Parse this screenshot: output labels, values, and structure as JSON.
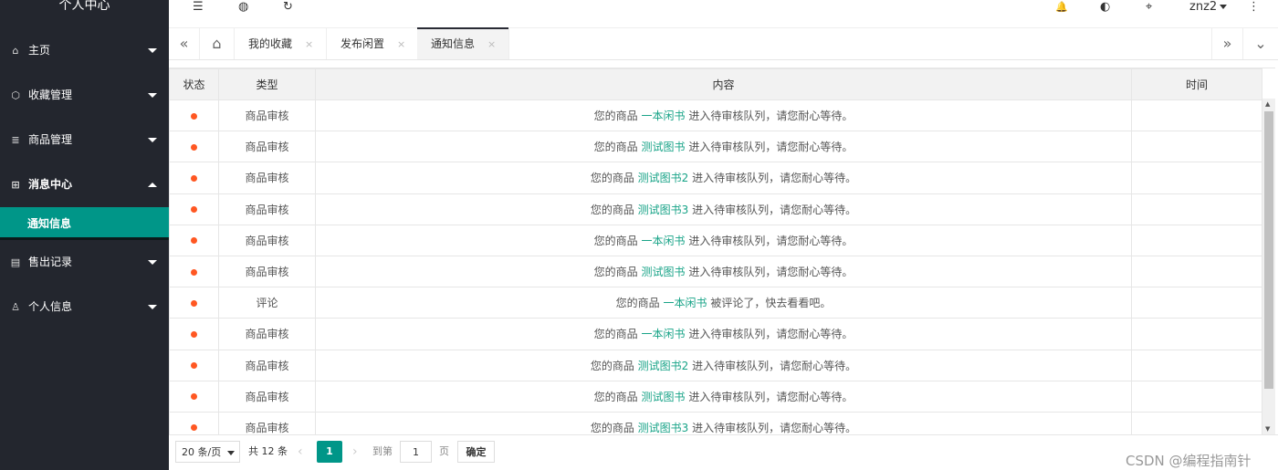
{
  "app_title": "个人中心",
  "sidebar": {
    "items": [
      {
        "label": "主页",
        "icon": "home-icon",
        "glyph": "⌂"
      },
      {
        "label": "收藏管理",
        "icon": "box-icon",
        "glyph": "⬡"
      },
      {
        "label": "商品管理",
        "icon": "list-icon",
        "glyph": "≣"
      },
      {
        "label": "消息中心",
        "icon": "apps-icon",
        "glyph": "⊞"
      },
      {
        "label": "售出记录",
        "icon": "file-icon",
        "glyph": "▤"
      },
      {
        "label": "个人信息",
        "icon": "user-icon",
        "glyph": "♙"
      }
    ],
    "sub_item": "通知信息"
  },
  "topbar": {
    "menu_icon": "☰",
    "globe_icon": "◍",
    "refresh_icon": "↻",
    "bell_icon": "🔔",
    "palette_icon": "◐",
    "tag_icon": "⌖",
    "more_icon": "⋮",
    "username": "znz2"
  },
  "tabs": {
    "prev": "«",
    "home": "⌂",
    "next": "»",
    "dropdown": "⌄",
    "items": [
      {
        "label": "我的收藏"
      },
      {
        "label": "发布闲置"
      },
      {
        "label": "通知信息"
      }
    ]
  },
  "table": {
    "headers": [
      "状态",
      "类型",
      "内容",
      "时间"
    ],
    "rows": [
      {
        "type": "商品审核",
        "pre": "您的商品 ",
        "link": "一本闲书",
        "post": " 进入待审核队列，请您耐心等待。",
        "time": ""
      },
      {
        "type": "商品审核",
        "pre": "您的商品 ",
        "link": "测试图书",
        "post": " 进入待审核队列，请您耐心等待。",
        "time": ""
      },
      {
        "type": "商品审核",
        "pre": "您的商品 ",
        "link": "测试图书2",
        "post": " 进入待审核队列，请您耐心等待。",
        "time": ""
      },
      {
        "type": "商品审核",
        "pre": "您的商品 ",
        "link": "测试图书3",
        "post": " 进入待审核队列，请您耐心等待。",
        "time": ""
      },
      {
        "type": "商品审核",
        "pre": "您的商品 ",
        "link": "一本闲书",
        "post": " 进入待审核队列，请您耐心等待。",
        "time": ""
      },
      {
        "type": "商品审核",
        "pre": "您的商品 ",
        "link": "测试图书",
        "post": " 进入待审核队列，请您耐心等待。",
        "time": ""
      },
      {
        "type": "评论",
        "pre": "您的商品 ",
        "link": "一本闲书",
        "post": " 被评论了，快去看看吧。",
        "time": ""
      },
      {
        "type": "商品审核",
        "pre": "您的商品 ",
        "link": "一本闲书",
        "post": " 进入待审核队列，请您耐心等待。",
        "time": ""
      },
      {
        "type": "商品审核",
        "pre": "您的商品 ",
        "link": "测试图书2",
        "post": " 进入待审核队列，请您耐心等待。",
        "time": ""
      },
      {
        "type": "商品审核",
        "pre": "您的商品 ",
        "link": "测试图书",
        "post": " 进入待审核队列，请您耐心等待。",
        "time": ""
      },
      {
        "type": "商品审核",
        "pre": "您的商品 ",
        "link": "测试图书3",
        "post": " 进入待审核队列，请您耐心等待。",
        "time": ""
      }
    ]
  },
  "pager": {
    "page_size": "20 条/页",
    "total": "共 12 条",
    "prev": "‹",
    "current": "1",
    "next": "›",
    "goto_label": "到第",
    "goto_value": "1",
    "page_unit": "页",
    "confirm": "确定"
  },
  "watermark": "CSDN @编程指南针",
  "colors": {
    "sidebar_bg": "#23262e",
    "accent": "#009688",
    "status_dot": "#ff5722",
    "link": "#17a387"
  }
}
